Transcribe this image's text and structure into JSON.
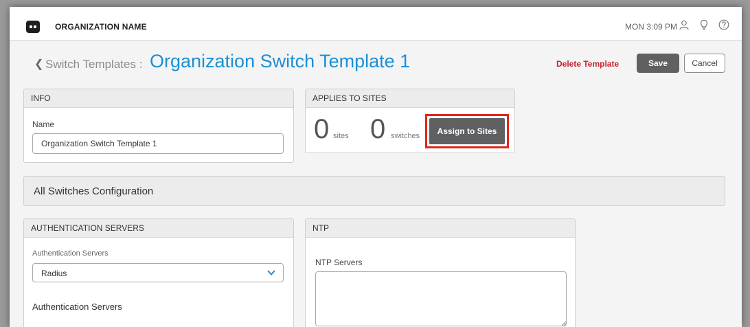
{
  "topbar": {
    "org_name": "ORGANIZATION NAME",
    "clock": "MON 3:09 PM",
    "icons": [
      "user-icon",
      "lightbulb-icon",
      "help-icon"
    ]
  },
  "title_row": {
    "breadcrumb_parent": "Switch Templates :",
    "page_title": "Organization Switch Template 1",
    "delete_label": "Delete Template",
    "save_label": "Save",
    "cancel_label": "Cancel"
  },
  "info": {
    "header": "INFO",
    "name_label": "Name",
    "name_value": "Organization Switch Template 1"
  },
  "applies": {
    "header": "APPLIES TO SITES",
    "sites_count": "0",
    "sites_label": "sites",
    "switches_count": "0",
    "switches_label": "switches",
    "assign_label": "Assign to Sites"
  },
  "config": {
    "title": "All Switches Configuration"
  },
  "auth": {
    "header": "AUTHENTICATION SERVERS",
    "field_label": "Authentication Servers",
    "selected_value": "Radius",
    "section_heading": "Authentication Servers"
  },
  "ntp": {
    "header": "NTP",
    "field_label": "NTP Servers",
    "value": ""
  },
  "colors": {
    "accent": "#1b8fd6",
    "danger": "#c8202d",
    "highlight": "#e1251b",
    "button_dark": "#5f6062"
  }
}
